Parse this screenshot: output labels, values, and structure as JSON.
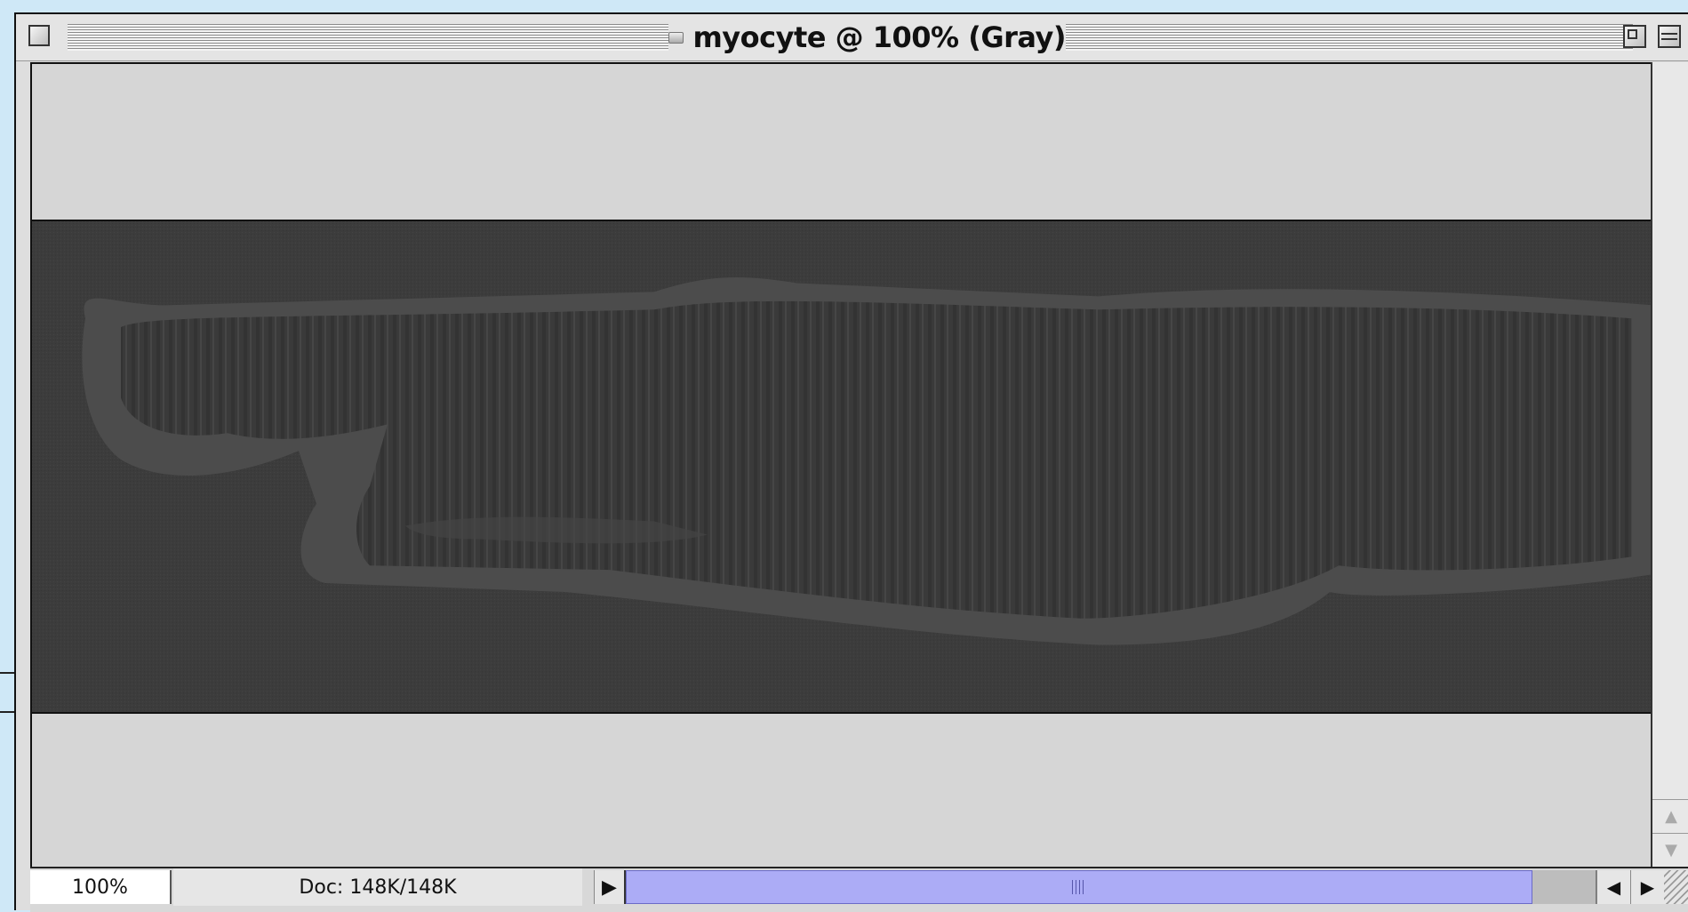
{
  "window": {
    "title": "myocyte @ 100% (Gray)"
  },
  "status_bar": {
    "zoom_level": "100%",
    "doc_info": "Doc: 148K/148K"
  },
  "icons": {
    "close": "close-box-icon",
    "proxy": "proxy-document-icon",
    "zoom": "zoom-box-icon",
    "collapse": "collapse-box-icon",
    "doc_menu": "triangle-right-icon",
    "scroll_left": "triangle-left-icon",
    "scroll_right": "triangle-right-icon",
    "scroll_up": "arrow-up-icon",
    "scroll_down": "arrow-down-icon",
    "grip": "scroll-grip-icon",
    "resize": "resize-grip-icon"
  },
  "colors": {
    "desktop": "#cfe8f7",
    "canvas_bg": "#d6d6d6",
    "image_bg": "#3b3b3b",
    "scroll_thumb": "#acacf6"
  }
}
